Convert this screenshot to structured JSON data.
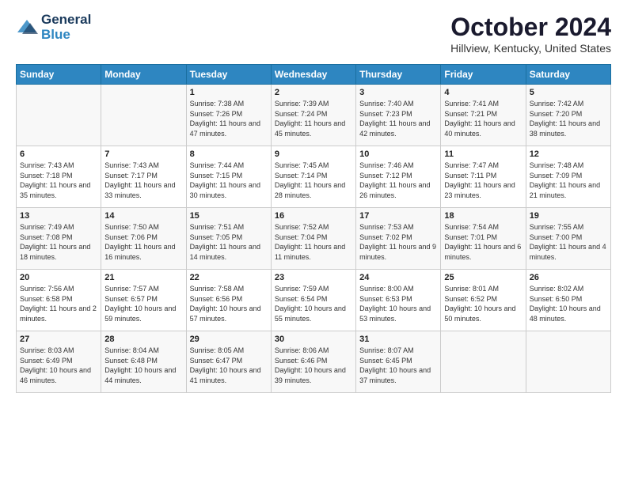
{
  "logo": {
    "line1": "General",
    "line2": "Blue"
  },
  "title": "October 2024",
  "subtitle": "Hillview, Kentucky, United States",
  "days_header": [
    "Sunday",
    "Monday",
    "Tuesday",
    "Wednesday",
    "Thursday",
    "Friday",
    "Saturday"
  ],
  "weeks": [
    [
      {
        "num": "",
        "sunrise": "",
        "sunset": "",
        "daylight": ""
      },
      {
        "num": "",
        "sunrise": "",
        "sunset": "",
        "daylight": ""
      },
      {
        "num": "1",
        "sunrise": "Sunrise: 7:38 AM",
        "sunset": "Sunset: 7:26 PM",
        "daylight": "Daylight: 11 hours and 47 minutes."
      },
      {
        "num": "2",
        "sunrise": "Sunrise: 7:39 AM",
        "sunset": "Sunset: 7:24 PM",
        "daylight": "Daylight: 11 hours and 45 minutes."
      },
      {
        "num": "3",
        "sunrise": "Sunrise: 7:40 AM",
        "sunset": "Sunset: 7:23 PM",
        "daylight": "Daylight: 11 hours and 42 minutes."
      },
      {
        "num": "4",
        "sunrise": "Sunrise: 7:41 AM",
        "sunset": "Sunset: 7:21 PM",
        "daylight": "Daylight: 11 hours and 40 minutes."
      },
      {
        "num": "5",
        "sunrise": "Sunrise: 7:42 AM",
        "sunset": "Sunset: 7:20 PM",
        "daylight": "Daylight: 11 hours and 38 minutes."
      }
    ],
    [
      {
        "num": "6",
        "sunrise": "Sunrise: 7:43 AM",
        "sunset": "Sunset: 7:18 PM",
        "daylight": "Daylight: 11 hours and 35 minutes."
      },
      {
        "num": "7",
        "sunrise": "Sunrise: 7:43 AM",
        "sunset": "Sunset: 7:17 PM",
        "daylight": "Daylight: 11 hours and 33 minutes."
      },
      {
        "num": "8",
        "sunrise": "Sunrise: 7:44 AM",
        "sunset": "Sunset: 7:15 PM",
        "daylight": "Daylight: 11 hours and 30 minutes."
      },
      {
        "num": "9",
        "sunrise": "Sunrise: 7:45 AM",
        "sunset": "Sunset: 7:14 PM",
        "daylight": "Daylight: 11 hours and 28 minutes."
      },
      {
        "num": "10",
        "sunrise": "Sunrise: 7:46 AM",
        "sunset": "Sunset: 7:12 PM",
        "daylight": "Daylight: 11 hours and 26 minutes."
      },
      {
        "num": "11",
        "sunrise": "Sunrise: 7:47 AM",
        "sunset": "Sunset: 7:11 PM",
        "daylight": "Daylight: 11 hours and 23 minutes."
      },
      {
        "num": "12",
        "sunrise": "Sunrise: 7:48 AM",
        "sunset": "Sunset: 7:09 PM",
        "daylight": "Daylight: 11 hours and 21 minutes."
      }
    ],
    [
      {
        "num": "13",
        "sunrise": "Sunrise: 7:49 AM",
        "sunset": "Sunset: 7:08 PM",
        "daylight": "Daylight: 11 hours and 18 minutes."
      },
      {
        "num": "14",
        "sunrise": "Sunrise: 7:50 AM",
        "sunset": "Sunset: 7:06 PM",
        "daylight": "Daylight: 11 hours and 16 minutes."
      },
      {
        "num": "15",
        "sunrise": "Sunrise: 7:51 AM",
        "sunset": "Sunset: 7:05 PM",
        "daylight": "Daylight: 11 hours and 14 minutes."
      },
      {
        "num": "16",
        "sunrise": "Sunrise: 7:52 AM",
        "sunset": "Sunset: 7:04 PM",
        "daylight": "Daylight: 11 hours and 11 minutes."
      },
      {
        "num": "17",
        "sunrise": "Sunrise: 7:53 AM",
        "sunset": "Sunset: 7:02 PM",
        "daylight": "Daylight: 11 hours and 9 minutes."
      },
      {
        "num": "18",
        "sunrise": "Sunrise: 7:54 AM",
        "sunset": "Sunset: 7:01 PM",
        "daylight": "Daylight: 11 hours and 6 minutes."
      },
      {
        "num": "19",
        "sunrise": "Sunrise: 7:55 AM",
        "sunset": "Sunset: 7:00 PM",
        "daylight": "Daylight: 11 hours and 4 minutes."
      }
    ],
    [
      {
        "num": "20",
        "sunrise": "Sunrise: 7:56 AM",
        "sunset": "Sunset: 6:58 PM",
        "daylight": "Daylight: 11 hours and 2 minutes."
      },
      {
        "num": "21",
        "sunrise": "Sunrise: 7:57 AM",
        "sunset": "Sunset: 6:57 PM",
        "daylight": "Daylight: 10 hours and 59 minutes."
      },
      {
        "num": "22",
        "sunrise": "Sunrise: 7:58 AM",
        "sunset": "Sunset: 6:56 PM",
        "daylight": "Daylight: 10 hours and 57 minutes."
      },
      {
        "num": "23",
        "sunrise": "Sunrise: 7:59 AM",
        "sunset": "Sunset: 6:54 PM",
        "daylight": "Daylight: 10 hours and 55 minutes."
      },
      {
        "num": "24",
        "sunrise": "Sunrise: 8:00 AM",
        "sunset": "Sunset: 6:53 PM",
        "daylight": "Daylight: 10 hours and 53 minutes."
      },
      {
        "num": "25",
        "sunrise": "Sunrise: 8:01 AM",
        "sunset": "Sunset: 6:52 PM",
        "daylight": "Daylight: 10 hours and 50 minutes."
      },
      {
        "num": "26",
        "sunrise": "Sunrise: 8:02 AM",
        "sunset": "Sunset: 6:50 PM",
        "daylight": "Daylight: 10 hours and 48 minutes."
      }
    ],
    [
      {
        "num": "27",
        "sunrise": "Sunrise: 8:03 AM",
        "sunset": "Sunset: 6:49 PM",
        "daylight": "Daylight: 10 hours and 46 minutes."
      },
      {
        "num": "28",
        "sunrise": "Sunrise: 8:04 AM",
        "sunset": "Sunset: 6:48 PM",
        "daylight": "Daylight: 10 hours and 44 minutes."
      },
      {
        "num": "29",
        "sunrise": "Sunrise: 8:05 AM",
        "sunset": "Sunset: 6:47 PM",
        "daylight": "Daylight: 10 hours and 41 minutes."
      },
      {
        "num": "30",
        "sunrise": "Sunrise: 8:06 AM",
        "sunset": "Sunset: 6:46 PM",
        "daylight": "Daylight: 10 hours and 39 minutes."
      },
      {
        "num": "31",
        "sunrise": "Sunrise: 8:07 AM",
        "sunset": "Sunset: 6:45 PM",
        "daylight": "Daylight: 10 hours and 37 minutes."
      },
      {
        "num": "",
        "sunrise": "",
        "sunset": "",
        "daylight": ""
      },
      {
        "num": "",
        "sunrise": "",
        "sunset": "",
        "daylight": ""
      }
    ]
  ]
}
